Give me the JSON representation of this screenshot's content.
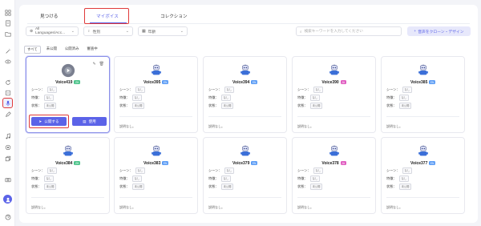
{
  "colors": {
    "accent": "#5b63e8",
    "highlight": "#e03a3a",
    "badge_green": "#4cc38a",
    "badge_blue": "#5b9cf5",
    "badge_pink": "#e05cc0"
  },
  "tabs": [
    {
      "label": "見つける"
    },
    {
      "label": "マイボイス"
    },
    {
      "label": "コレクション"
    }
  ],
  "filters": {
    "language": "All Languages/Acc...",
    "gender": "性別",
    "age": "年齢"
  },
  "search": {
    "placeholder": "検索キーワードを入力してください"
  },
  "design_button": "音声をクローン・デザイン",
  "subtabs": [
    {
      "label": "すべて"
    },
    {
      "label": "未公開"
    },
    {
      "label": "公開済み"
    },
    {
      "label": "審査中"
    }
  ],
  "labels": {
    "scene": "シーン：",
    "characteristic": "特徴：",
    "status": "状態："
  },
  "buttons": {
    "publish": "公開する",
    "use": "使用"
  },
  "cards": [
    {
      "title": "Voice419",
      "badge": "ZH",
      "badge_color": "#4cc38a",
      "scene": "なし",
      "feature": "なし",
      "status": "未公開",
      "desc": "説明なし",
      "icon": "play-icon"
    },
    {
      "title": "Voice395",
      "badge": "EN",
      "badge_color": "#5b9cf5",
      "scene": "なし",
      "feature": "なし",
      "status": "未公開",
      "desc": "説明なし。",
      "icon": "robot-icon"
    },
    {
      "title": "Voice394",
      "badge": "EN",
      "badge_color": "#5b9cf5",
      "scene": "なし",
      "feature": "なし",
      "status": "未公開",
      "desc": "説明なし。",
      "icon": "robot-icon"
    },
    {
      "title": "Voice390",
      "badge": "JA",
      "badge_color": "#e05cc0",
      "scene": "なし",
      "feature": "なし",
      "status": "未公開",
      "desc": "説明なし。",
      "icon": "robot-icon"
    },
    {
      "title": "Voice385",
      "badge": "EN",
      "badge_color": "#5b9cf5",
      "scene": "なし",
      "feature": "なし",
      "status": "未公開",
      "desc": "説明なし。",
      "icon": "robot-icon"
    },
    {
      "title": "Voice384",
      "badge": "ZH",
      "badge_color": "#4cc38a",
      "scene": "なし",
      "feature": "なし",
      "status": "未公開",
      "desc": "説明なし。",
      "icon": "robot-icon"
    },
    {
      "title": "Voice383",
      "badge": "EN",
      "badge_color": "#5b9cf5",
      "scene": "なし",
      "feature": "なし",
      "status": "未公開",
      "desc": "説明なし。",
      "icon": "robot-icon"
    },
    {
      "title": "Voice379",
      "badge": "EN",
      "badge_color": "#5b9cf5",
      "scene": "なし",
      "feature": "なし",
      "status": "未公開",
      "desc": "説明なし。",
      "icon": "robot-icon"
    },
    {
      "title": "Voice378",
      "badge": "JA",
      "badge_color": "#e05cc0",
      "scene": "なし",
      "feature": "なし",
      "status": "未公開",
      "desc": "説明なし。",
      "icon": "robot-icon"
    },
    {
      "title": "Voice377",
      "badge": "EN",
      "badge_color": "#5b9cf5",
      "scene": "なし",
      "feature": "なし",
      "status": "未公開",
      "desc": "説明なし。",
      "icon": "robot-icon"
    }
  ],
  "sidebar": {
    "icons": [
      "grid-icon",
      "note-icon",
      "folder-icon",
      "magic-wand-icon",
      "eye-icon",
      "refresh-icon",
      "layers-icon",
      "microphone-icon",
      "edit-icon",
      "music-icon",
      "target-icon",
      "copy-icon",
      "camera-icon",
      "user-avatar-icon",
      "help-icon"
    ],
    "active": "microphone-icon"
  }
}
